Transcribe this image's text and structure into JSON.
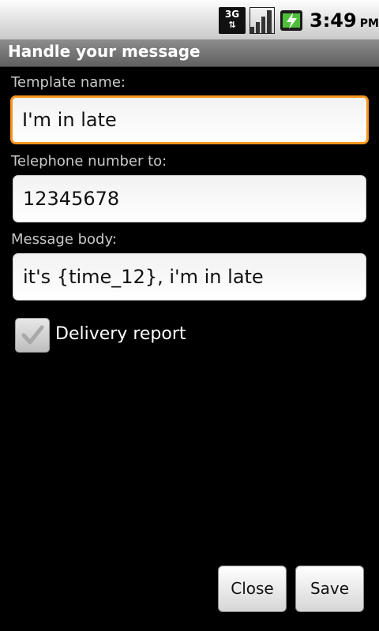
{
  "status_bar": {
    "network": "3G",
    "network_icon": "3g-data-icon",
    "signal_icon": "signal-strength-icon",
    "battery_icon": "battery-charging-icon",
    "time": "3:49",
    "ampm": "PM"
  },
  "title_bar": {
    "title": "Handle your message"
  },
  "form": {
    "template_name": {
      "label": "Template name:",
      "value": "I'm in late"
    },
    "telephone": {
      "label": "Telephone number to:",
      "value": "12345678"
    },
    "message_body": {
      "label": "Message body:",
      "value": "it's {time_12}, i'm in late"
    },
    "delivery_report": {
      "label": "Delivery report",
      "checked": true
    }
  },
  "buttons": {
    "close": "Close",
    "save": "Save"
  },
  "colors": {
    "focus_border": "#f7961d",
    "background": "#000000"
  }
}
